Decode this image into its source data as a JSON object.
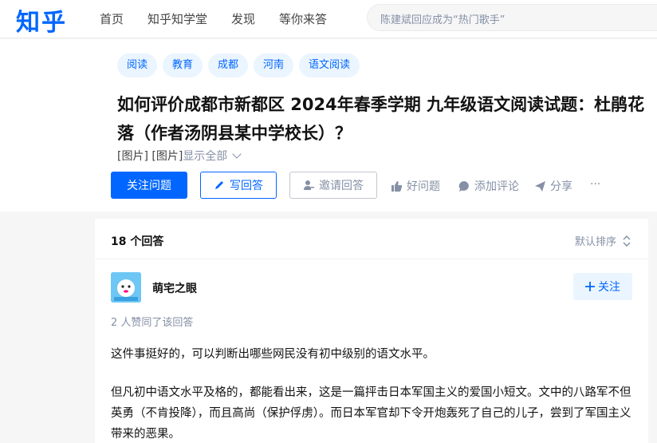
{
  "logo": "知乎",
  "nav": [
    "首页",
    "知乎知学堂",
    "发现",
    "等你来答"
  ],
  "search": {
    "placeholder": "陈建斌回应成为“热门歌手”"
  },
  "question": {
    "tags": [
      "阅读",
      "教育",
      "成都",
      "河南",
      "语文阅读"
    ],
    "title": "如何评价成都市新都区 2024年春季学期 九年级语文阅读试题：杜鹃花落（作者汤阴县某中学校长）？",
    "desc": "[图片] [图片]",
    "show_all": "显示全部",
    "actions": {
      "follow": "关注问题",
      "write": "写回答",
      "invite": "邀请回答",
      "good": "好问题",
      "comment": "添加评论",
      "share": "分享",
      "more": "···"
    }
  },
  "answers": {
    "count_label": "18 个回答",
    "sort_label": "默认排序",
    "author": "萌宅之眼",
    "follow_label": "关注",
    "votes_label": "2 人赞同了该回答",
    "paragraphs": [
      "这件事挺好的，可以判断出哪些网民没有初中级别的语文水平。",
      "但凡初中语文水平及格的，都能看出来，这是一篇抨击日本军国主义的爱国小短文。文中的八路军不但英勇（不肯投降），而且高尚（保护俘虏）。而日本军官却下令开炮轰死了自己的儿子，尝到了军国主义带来的恶果。"
    ]
  },
  "colors": {
    "accent": "#0066ff",
    "tag_bg": "#ebf5ff",
    "muted": "#8590a6"
  }
}
